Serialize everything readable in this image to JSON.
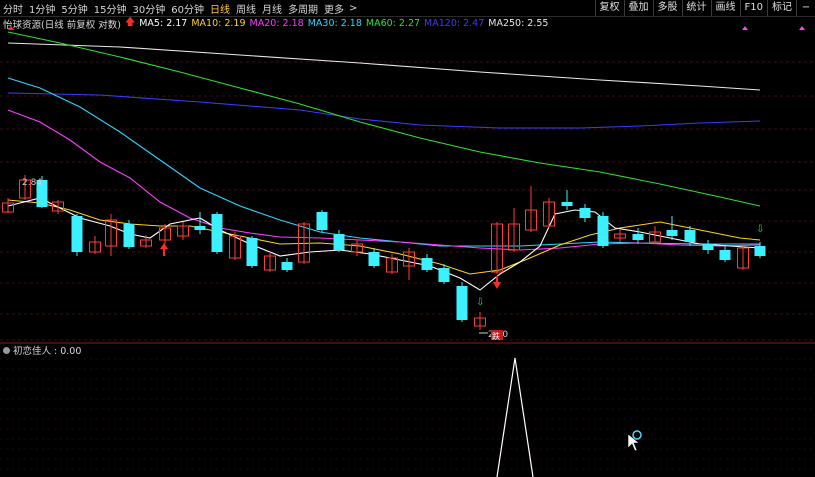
{
  "toolbar": {
    "periods": [
      "分时",
      "1分钟",
      "5分钟",
      "15分钟",
      "30分钟",
      "60分钟",
      "日线",
      "周线",
      "月线",
      "多周期",
      "更多"
    ],
    "active_period": "日线",
    "more_chevron": ">",
    "right_buttons": [
      "复权",
      "叠加",
      "多股",
      "统计",
      "画线",
      "F10",
      "标记"
    ],
    "right_icon": "−"
  },
  "info": {
    "stock": "怡球资源(日线 前复权 对数)",
    "ma": [
      {
        "label": "MA5: 2.17",
        "color": "#ffffff"
      },
      {
        "label": "MA10: 2.19",
        "color": "#ffd21a"
      },
      {
        "label": "MA20: 2.18",
        "color": "#ff3cff"
      },
      {
        "label": "MA30: 2.18",
        "color": "#2ad7ff"
      },
      {
        "label": "MA60: 2.27",
        "color": "#2ee02e"
      },
      {
        "label": "MA120: 2.47",
        "color": "#3b3bff"
      },
      {
        "label": "MA250: 2.55",
        "color": "#e8e8e8"
      }
    ]
  },
  "price_labels": {
    "high": "2.84",
    "low": "2.20"
  },
  "markers": {
    "fall_glyph": "跌"
  },
  "indicator": {
    "label": "初恋佳人 : 0.00"
  },
  "colors": {
    "up": "#ff3c3c",
    "down": "#3cf0ff",
    "grid": "#3a0f0f"
  }
}
